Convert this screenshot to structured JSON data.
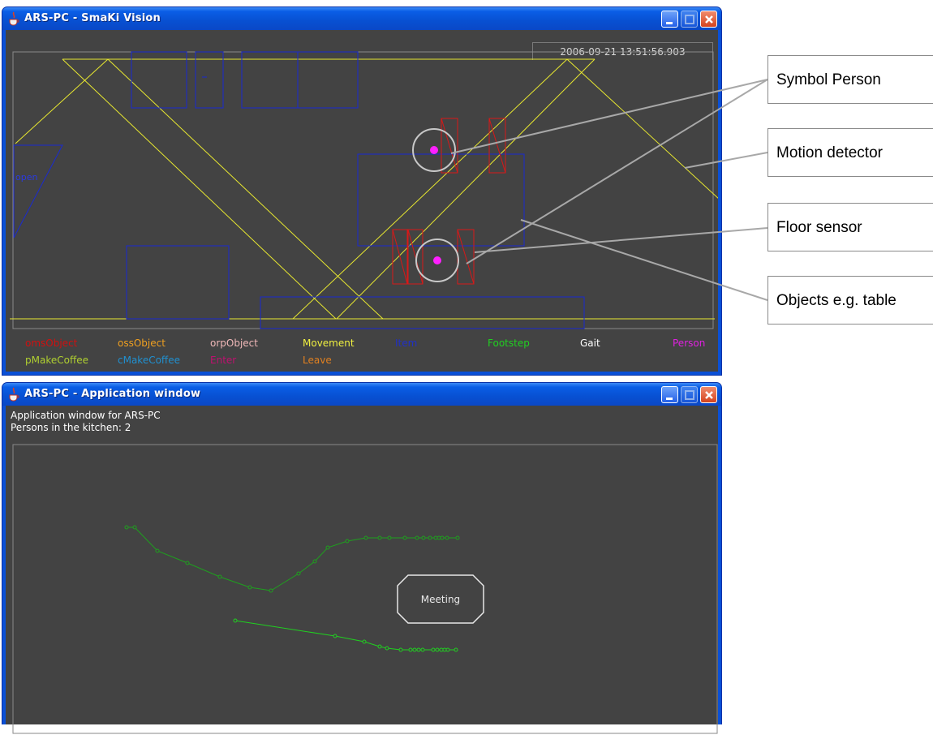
{
  "vision_window": {
    "title": "ARS-PC - SmaKi Vision",
    "timestamp": "2006-09-21 13:51:56.903",
    "open_label": "open",
    "legend": [
      {
        "label": "omsObject",
        "color": "#d01010"
      },
      {
        "label": "ossObject",
        "color": "#f0a020"
      },
      {
        "label": "orpObject",
        "color": "#f0b8b8"
      },
      {
        "label": "Movement",
        "color": "#f0f040"
      },
      {
        "label": "Item",
        "color": "#2030c8"
      },
      {
        "label": "Footstep",
        "color": "#20d020"
      },
      {
        "label": "Gait",
        "color": "#ffffff"
      },
      {
        "label": "Person",
        "color": "#e020e0"
      },
      {
        "label": "pMakeCoffee",
        "color": "#b0d030"
      },
      {
        "label": "cMakeCoffee",
        "color": "#2090d0"
      },
      {
        "label": "Enter",
        "color": "#c01070"
      },
      {
        "label": "Leave",
        "color": "#e08020"
      }
    ]
  },
  "app_window": {
    "title": "ARS-PC - Application window",
    "header_line1": "Application window for ARS-PC",
    "header_line2": "Persons in the kitchen: 2",
    "meeting_label": "Meeting"
  },
  "callouts": {
    "symbol_person": "Symbol Person",
    "motion_detector": "Motion detector",
    "floor_sensor": "Floor sensor",
    "objects_table": "Objects e.g. table"
  }
}
